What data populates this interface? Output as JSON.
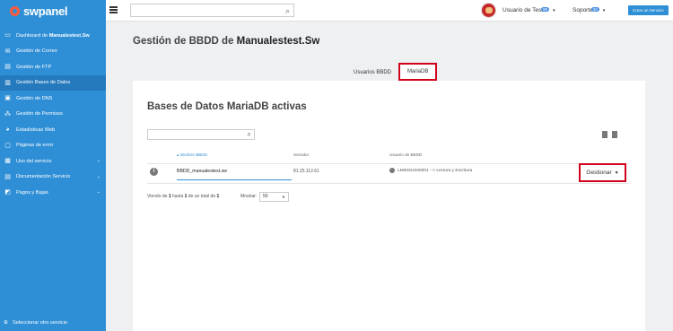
{
  "app": {
    "logo_text": "swpanel",
    "brand_color": "#2f8fd6",
    "highlight_color": "#d0021b"
  },
  "sidebar": {
    "items": [
      {
        "icon": "dashboard-icon",
        "label_prefix": "Dashboard de ",
        "label_bold": "Manualestest.Sw",
        "active": false
      },
      {
        "icon": "mail-icon",
        "label": "Gestión de Correo",
        "active": false
      },
      {
        "icon": "ftp-icon",
        "label": "Gestión de FTP",
        "active": false
      },
      {
        "icon": "database-icon",
        "label": "Gestión Bases de Datos",
        "active": true
      },
      {
        "icon": "dns-icon",
        "label": "Gestión de DNS",
        "active": false
      },
      {
        "icon": "permissions-icon",
        "label": "Gestión de Permisos",
        "active": false
      },
      {
        "icon": "stats-icon",
        "label": "Estadísticas Web",
        "active": false
      },
      {
        "icon": "error-page-icon",
        "label": "Páginas de error",
        "active": false
      },
      {
        "icon": "usage-icon",
        "label": "Uso del servicio",
        "active": false
      },
      {
        "icon": "docs-icon",
        "label": "Documentación Servicio",
        "active": false
      },
      {
        "icon": "payments-icon",
        "label": "Pagos y Bajas",
        "active": false
      }
    ],
    "footer_label": "Seleccionar otro servicio"
  },
  "topbar": {
    "search_placeholder": "",
    "user_name": "Usuario de Test",
    "user_badge": "99",
    "support_label": "Soporte",
    "support_badge": "32",
    "create_button": "Crear un Servicio"
  },
  "page": {
    "title_prefix": "Gestión de BBDD de ",
    "title_bold": "Manualestest.Sw",
    "tabs": [
      {
        "label": "Usuarios BBDD",
        "active": false
      },
      {
        "label": "MariaDB",
        "active": true
      }
    ]
  },
  "panel": {
    "title": "Bases de Datos MariaDB activas",
    "table": {
      "headers": [
        "Nombre BBDD",
        "Servidor",
        "Usuario de BBDD"
      ],
      "sort_arrow": "▴",
      "rows": [
        {
          "name": "BBDD_manualestest.sw",
          "server": "81.25.112.61",
          "user": "LM003US00001 --> Lectura y Escritura",
          "action": "Gestionar"
        }
      ]
    },
    "pagination": {
      "text_1": "Viendo de ",
      "from": "1",
      "text_2": " hasta ",
      "to": "1",
      "text_3": " de un total de ",
      "total": "1",
      "show_label": "Mostrar:",
      "page_size": "50"
    }
  }
}
